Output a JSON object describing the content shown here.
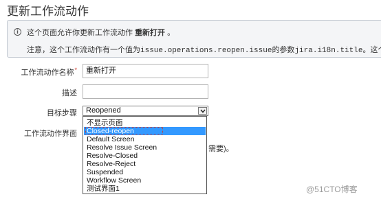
{
  "page": {
    "title": "更新工作流动作"
  },
  "info": {
    "line1_prefix": "这个页面允许你更新工作流动作",
    "line1_action": "重新打开",
    "line1_suffix": "。",
    "line2_prefix": "注意，这个工作流动作有一个值为",
    "line2_code1": "issue.operations.reopen.issue",
    "line2_middle": "的参数",
    "line2_code2": "jira.i18n.title",
    "line2_suffix": "。这个参数"
  },
  "form": {
    "name_label": "工作流动作名称",
    "name_required": "*",
    "name_value": "重新打开",
    "desc_label": "描述",
    "desc_value": "",
    "dest_label": "目标步骤",
    "dest_value": "Reopened",
    "screen_label": "工作流动作界面",
    "screen_hint": "需要)。"
  },
  "dropdown": {
    "options": [
      "不显示页面",
      "Closed-reopen",
      "Default Screen",
      "Resolve Issue Screen",
      "Resolve-Closed",
      "Resolve-Reject",
      "Suspended",
      "Workflow Screen",
      "测试界面1"
    ],
    "selected_index": 1
  },
  "watermark": "@51CTO博客",
  "colors": {
    "selected_bg": "#3399ff",
    "required": "#d04437",
    "info_bg": "#f4f5f7"
  }
}
